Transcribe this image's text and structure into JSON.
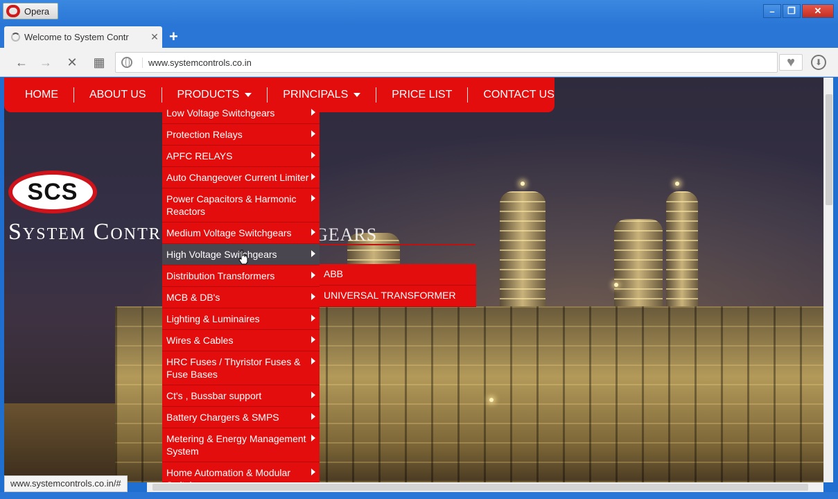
{
  "browser": {
    "app_name": "Opera",
    "tab_title": "Welcome to System Contr",
    "tab_close": "✕",
    "new_tab": "+",
    "url": "www.systemcontrols.co.in",
    "status_url": "www.systemcontrols.co.in/#",
    "window_buttons": {
      "minimize": "–",
      "maximize": "❐",
      "close": "✕"
    },
    "nav_icons": {
      "back": "←",
      "forward": "→",
      "stop": "✕",
      "speed_dial": "▦",
      "bookmark": "♥",
      "download": "⬇"
    }
  },
  "site": {
    "nav": [
      "HOME",
      "ABOUT US",
      "PRODUCTS",
      "PRINCIPALS",
      "PRICE LIST",
      "CONTACT US"
    ],
    "logo_text": "SCS",
    "company_name": "System Contr",
    "company_name_tail": "GEARS",
    "products_menu": [
      "Low Voltage Switchgears",
      "Protection Relays",
      "APFC RELAYS",
      "Auto Changeover Current Limiter",
      "Power Capacitors & Harmonic Reactors",
      "Medium Voltage Switchgears",
      "High Voltage Switchgears",
      "Distribution Transformers",
      "MCB & DB's",
      "Lighting & Luminaires",
      "Wires & Cables",
      "HRC Fuses / Thyristor Fuses & Fuse Bases",
      "Ct's , Bussbar support",
      "Battery Chargers & SMPS",
      "Metering & Energy Management System",
      "Home Automation & Modular Switches"
    ],
    "hovered_item": "High Voltage Switchgears",
    "submenu": [
      "ABB",
      "UNIVERSAL TRANSFORMER"
    ]
  },
  "colors": {
    "menu_red": "#e40d0d",
    "hover_gray": "#4a4650",
    "chrome_blue": "#2a76d6"
  }
}
